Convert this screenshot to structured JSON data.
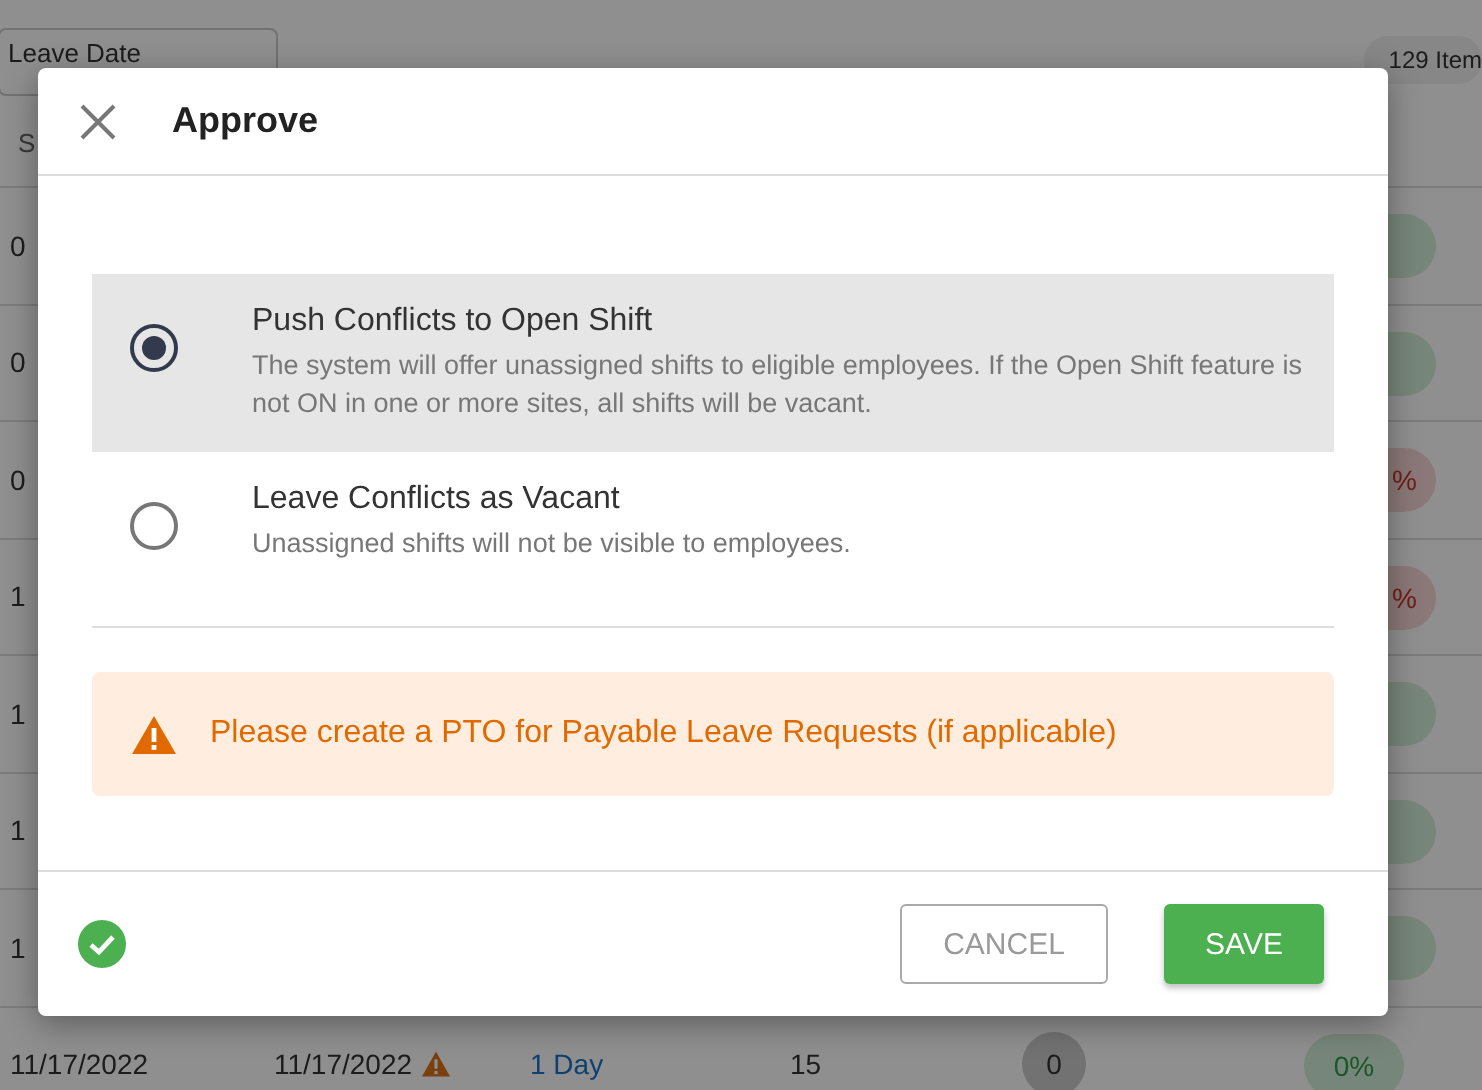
{
  "page": {
    "filter": "Leave Date",
    "item_count": "129 Item",
    "column_1": "S"
  },
  "rows": [
    {
      "cell_1": "0",
      "flagged": false
    },
    {
      "cell_1": "0",
      "flagged": false
    },
    {
      "cell_1": "0",
      "pill": "%",
      "flagged": true
    },
    {
      "cell_1": "1",
      "pill": "%",
      "flagged": true
    },
    {
      "cell_1": "1",
      "flagged": false
    },
    {
      "cell_1": "1",
      "flagged": false
    },
    {
      "cell_1": "1",
      "flagged": false
    },
    {
      "cell_1": "11/17/2022",
      "cell_2": "11/17/2022",
      "warning": true,
      "cell_3": "1 Day",
      "cell_4": "15",
      "count": "0",
      "pill": "0%",
      "flagged": false
    }
  ],
  "dialog": {
    "title": "Approve",
    "options": [
      {
        "label": "Push Conflicts to Open Shift",
        "description": "The system will offer unassigned shifts to eligible employees. If the Open Shift feature is not ON in one or more sites, all shifts will be vacant.",
        "selected": true
      },
      {
        "label": "Leave Conflicts as Vacant",
        "description": "Unassigned shifts will not be visible to employees.",
        "selected": false
      }
    ],
    "alert": "Please create a PTO for Payable Leave Requests (if applicable)",
    "buttons": [
      {
        "label": "CANCEL",
        "kind": "secondary"
      },
      {
        "label": "SAVE",
        "kind": "primary"
      }
    ]
  }
}
